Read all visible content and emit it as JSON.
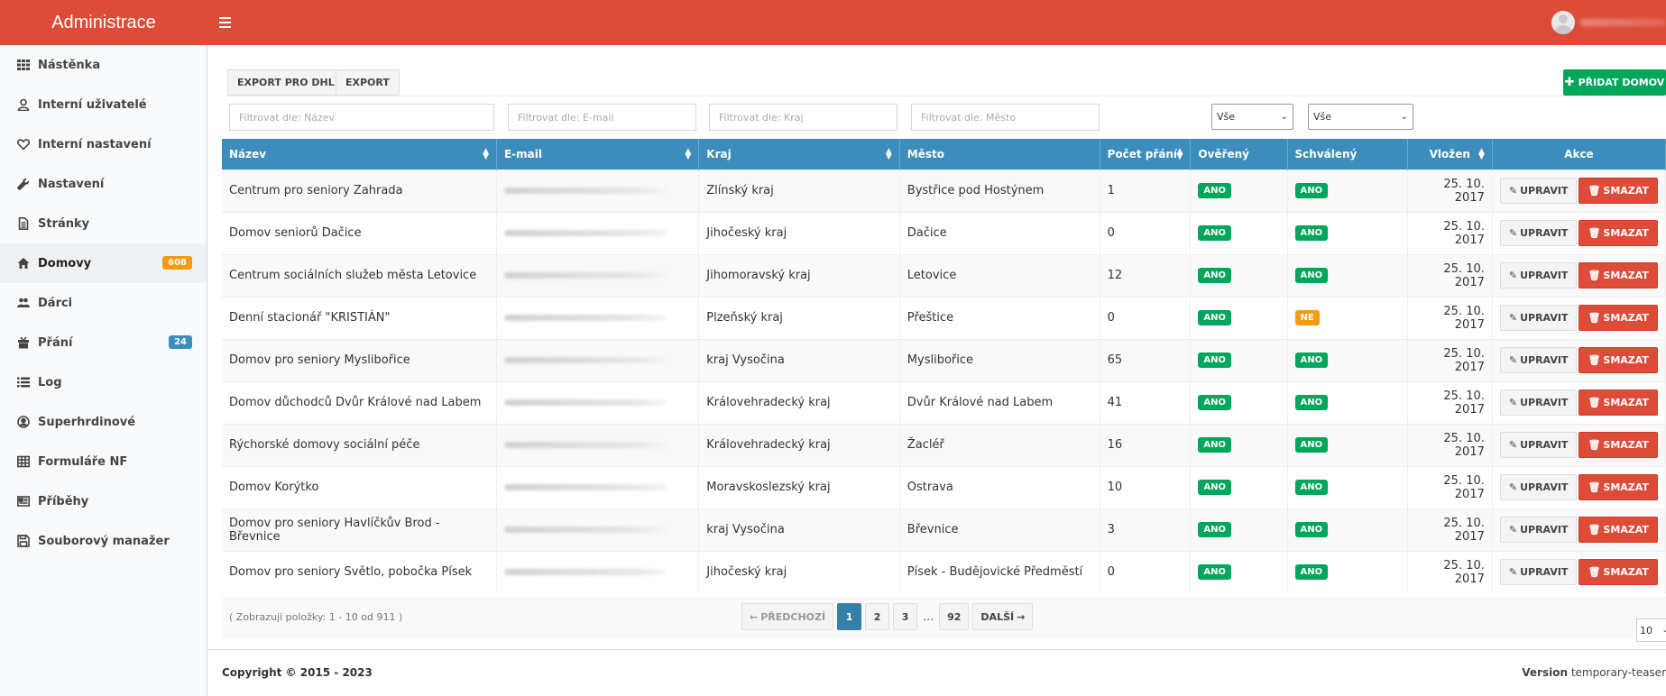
{
  "app": {
    "title": "Administrace"
  },
  "sidebar": {
    "items": [
      {
        "label": "Nástěnka",
        "icon": "th-icon"
      },
      {
        "label": "Interní uživatelé",
        "icon": "user-icon"
      },
      {
        "label": "Interní nastavení",
        "icon": "heart-icon"
      },
      {
        "label": "Nastavení",
        "icon": "wrench-icon"
      },
      {
        "label": "Stránky",
        "icon": "file-icon"
      },
      {
        "label": "Domovy",
        "icon": "home-icon",
        "badge": "608",
        "active": true
      },
      {
        "label": "Dárci",
        "icon": "users-icon"
      },
      {
        "label": "Přání",
        "icon": "gift-icon",
        "badge": "24"
      },
      {
        "label": "Log",
        "icon": "list-icon"
      },
      {
        "label": "Superhrdinové",
        "icon": "user-circle-icon"
      },
      {
        "label": "Formuláře NF",
        "icon": "table-icon"
      },
      {
        "label": "Příběhy",
        "icon": "newspaper-icon"
      },
      {
        "label": "Souborový manažer",
        "icon": "save-icon"
      }
    ]
  },
  "toolbar": {
    "export_dhl": "EXPORT PRO DHL",
    "export": "EXPORT",
    "add": "PŘIDAT DOMOV"
  },
  "filters": {
    "name_placeholder": "Filtrovat dle: Název",
    "email_placeholder": "Filtrovat dle: E-mail",
    "region_placeholder": "Filtrovat dle: Kraj",
    "city_placeholder": "Filtrovat dle: Město",
    "verified_value": "Vše",
    "approved_value": "Vše"
  },
  "table": {
    "headers": {
      "name": "Název",
      "email": "E-mail",
      "region": "Kraj",
      "city": "Město",
      "wishes": "Počet přání",
      "verified": "Ověřený",
      "approved": "Schválený",
      "created": "Vložen",
      "actions": "Akce"
    },
    "edit_label": "UPRAVIT",
    "delete_label": "SMAZAT",
    "rows": [
      {
        "name": "Centrum pro seniory Zahrada",
        "region": "Zlínský kraj",
        "city": "Bystřice pod Hostýnem",
        "wishes": "1",
        "verified": "ANO",
        "approved": "ANO",
        "created": "25. 10. 2017"
      },
      {
        "name": "Domov seniorů Dačice",
        "region": "Jihočeský kraj",
        "city": "Dačice",
        "wishes": "0",
        "verified": "ANO",
        "approved": "ANO",
        "created": "25. 10. 2017"
      },
      {
        "name": "Centrum sociálních služeb města Letovice",
        "region": "Jihomoravský kraj",
        "city": "Letovice",
        "wishes": "12",
        "verified": "ANO",
        "approved": "ANO",
        "created": "25. 10. 2017"
      },
      {
        "name": "Denní stacionář \"KRISTIÁN\"",
        "region": "Plzeňský kraj",
        "city": "Přeštice",
        "wishes": "0",
        "verified": "ANO",
        "approved": "NE",
        "created": "25. 10. 2017"
      },
      {
        "name": "Domov pro seniory Myslibořice",
        "region": "kraj Vysočina",
        "city": "Myslibořice",
        "wishes": "65",
        "verified": "ANO",
        "approved": "ANO",
        "created": "25. 10. 2017"
      },
      {
        "name": "Domov důchodců Dvůr Králové nad Labem",
        "region": "Královehradecký kraj",
        "city": "Dvůr Králové nad Labem",
        "wishes": "41",
        "verified": "ANO",
        "approved": "ANO",
        "created": "25. 10. 2017"
      },
      {
        "name": "Rýchorské domovy sociální péče",
        "region": "Královehradecký kraj",
        "city": "Žacléř",
        "wishes": "16",
        "verified": "ANO",
        "approved": "ANO",
        "created": "25. 10. 2017"
      },
      {
        "name": "Domov Korýtko",
        "region": "Moravskoslezský kraj",
        "city": "Ostrava",
        "wishes": "10",
        "verified": "ANO",
        "approved": "ANO",
        "created": "25. 10. 2017"
      },
      {
        "name": "Domov pro seniory Havlíčkův Brod - Břevnice",
        "region": "kraj Vysočina",
        "city": "Břevnice",
        "wishes": "3",
        "verified": "ANO",
        "approved": "ANO",
        "created": "25. 10. 2017"
      },
      {
        "name": "Domov pro seniory Světlo, pobočka Písek",
        "region": "Jihočeský kraj",
        "city": "Písek - Budějovické Předměstí",
        "wishes": "0",
        "verified": "ANO",
        "approved": "ANO",
        "created": "25. 10. 2017"
      }
    ]
  },
  "pagination": {
    "showing": "( Zobrazuji položky: 1 - 10 od 911 )",
    "prev": "PŘEDCHOZÍ",
    "pages": [
      "1",
      "2",
      "3"
    ],
    "ellipsis": "…",
    "last": "92",
    "next": "DALŠÍ",
    "per_page": "10"
  },
  "footer": {
    "copyright": "Copyright © 2015 - 2023",
    "version_label": "Version",
    "version_value": "temporary-teaser"
  },
  "colors": {
    "topbar": "#dd4b39",
    "table_header": "#3c8dbc",
    "success": "#00a65a",
    "warning": "#f39c12",
    "danger": "#dd4b39"
  }
}
